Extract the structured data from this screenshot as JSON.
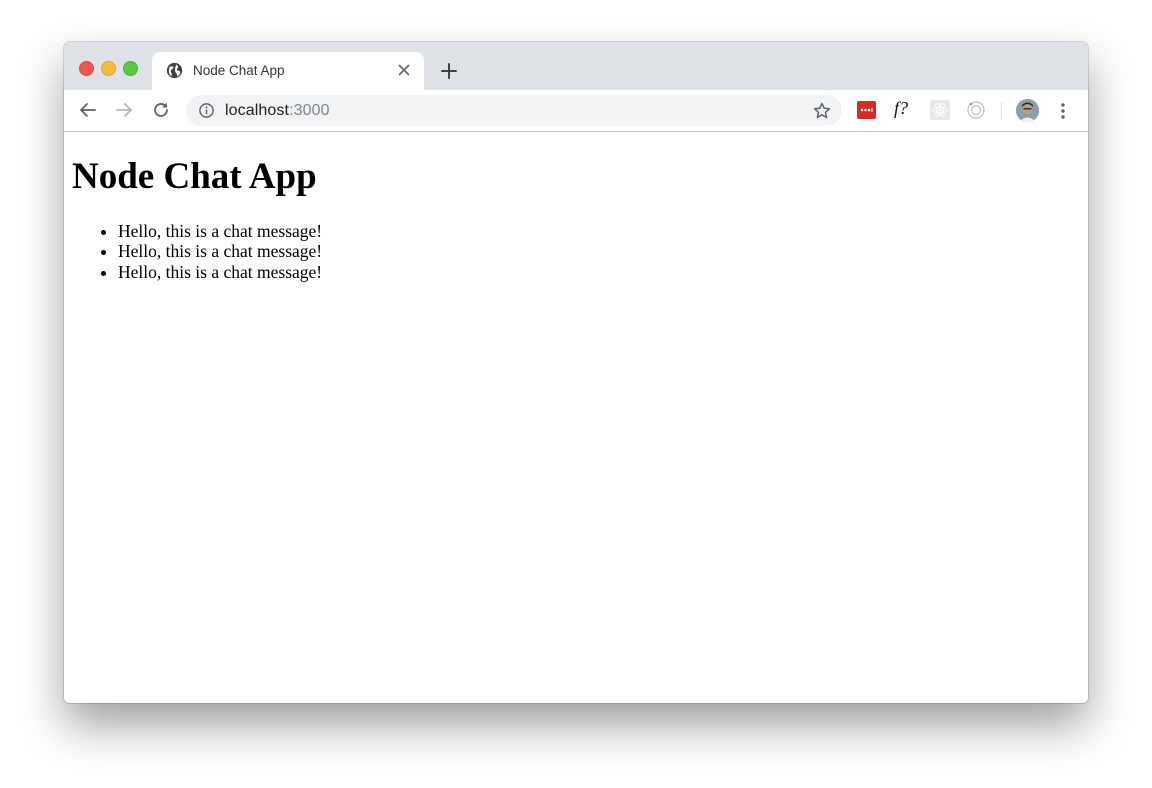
{
  "browser": {
    "tab": {
      "title": "Node Chat App",
      "favicon": "globe-icon",
      "close_icon": "close-icon"
    },
    "new_tab_icon": "plus-icon",
    "nav": {
      "back_icon": "arrow-left-icon",
      "forward_icon": "arrow-right-icon",
      "reload_icon": "reload-icon"
    },
    "address_bar": {
      "host": "localhost",
      "port": ":3000",
      "security_icon": "info-icon",
      "bookmark_icon": "star-icon"
    },
    "extensions": [
      {
        "name": "lastpass",
        "icon": "lastpass-icon",
        "color": "#d32d27"
      },
      {
        "name": "fontface-ninja",
        "label": "f?"
      },
      {
        "name": "react-devtools",
        "icon": "react-icon"
      },
      {
        "name": "target-extension",
        "icon": "target-icon"
      }
    ],
    "profile_icon": "avatar",
    "menu_icon": "kebab-menu-icon"
  },
  "page": {
    "heading": "Node Chat App",
    "messages": [
      "Hello, this is a chat message!",
      "Hello, this is a chat message!",
      "Hello, this is a chat message!"
    ]
  }
}
